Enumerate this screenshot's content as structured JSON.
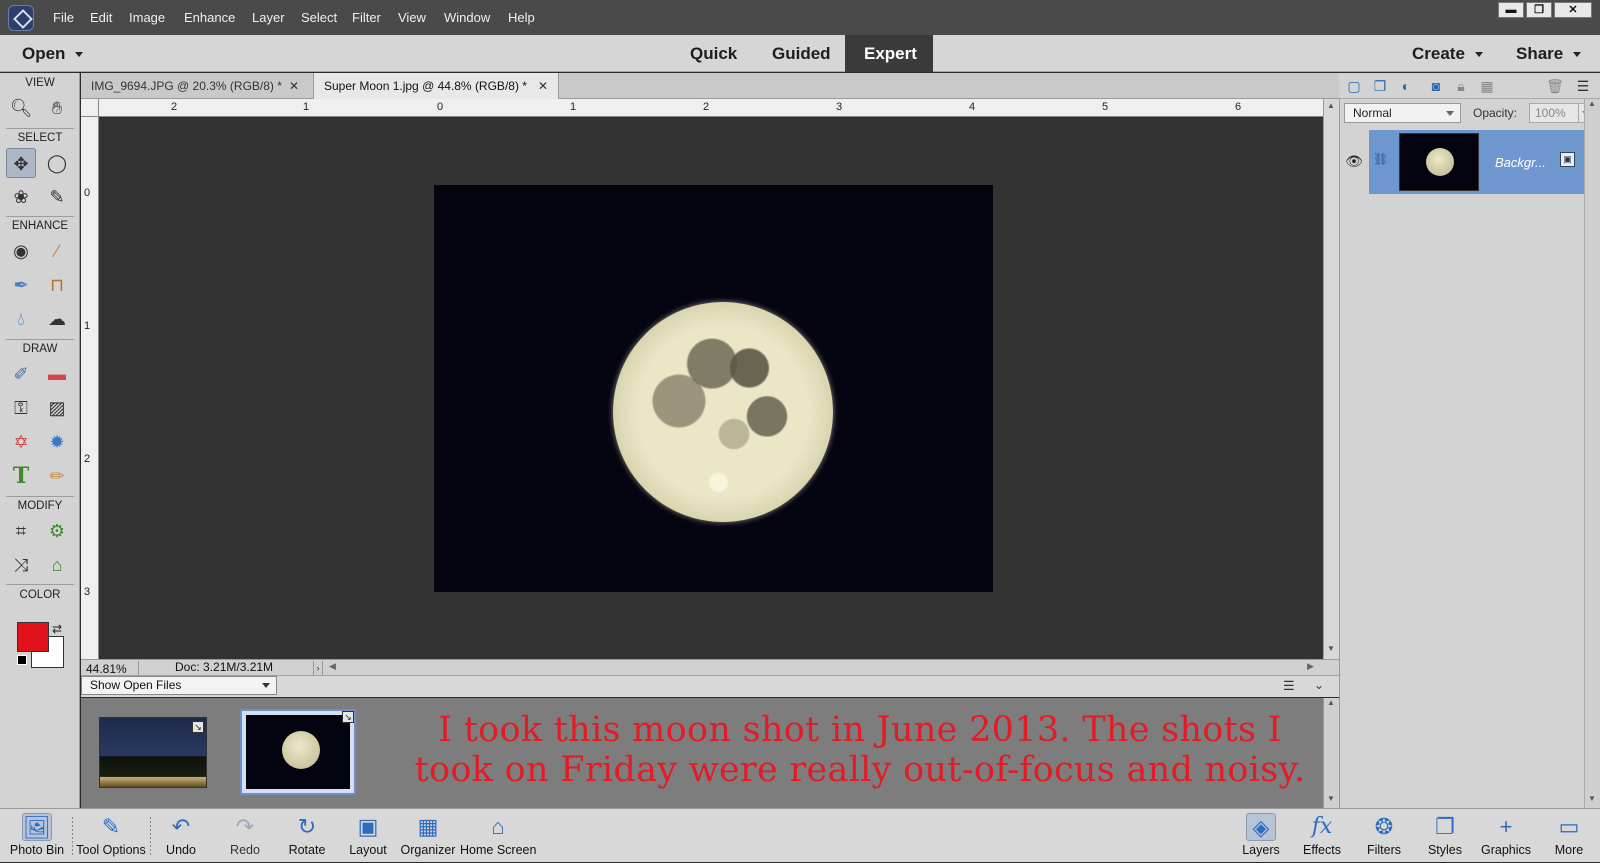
{
  "menubar": {
    "items": [
      "File",
      "Edit",
      "Image",
      "Enhance",
      "Layer",
      "Select",
      "Filter",
      "View",
      "Window",
      "Help"
    ]
  },
  "window_controls": {
    "minimize": "▬",
    "restore": "❐",
    "close": "✕"
  },
  "modebar": {
    "open": "Open",
    "modes": [
      "Quick",
      "Guided",
      "Expert"
    ],
    "active_mode": "Expert",
    "create": "Create",
    "share": "Share"
  },
  "toolbox": {
    "sections": [
      "VIEW",
      "SELECT",
      "ENHANCE",
      "DRAW",
      "MODIFY",
      "COLOR"
    ],
    "colors": {
      "foreground": "#e0111b",
      "background": "#ffffff"
    }
  },
  "tabs": [
    {
      "label": "IMG_9694.JPG @ 20.3% (RGB/8) *"
    },
    {
      "label": "Super Moon 1.jpg @ 44.8% (RGB/8) *"
    }
  ],
  "ruler_top": [
    "2",
    "1",
    "0",
    "1",
    "2",
    "3",
    "4",
    "5",
    "6"
  ],
  "ruler_left": [
    "0",
    "1",
    "2",
    "3"
  ],
  "status": {
    "zoom": "44.81%",
    "doc": "Doc: 3.21M/3.21M"
  },
  "photo_bin": {
    "dropdown": "Show Open Files",
    "caption": "I took this moon shot in June 2013. The shots I took on Friday were really out-of-focus and noisy."
  },
  "layers_panel": {
    "blend_mode": "Normal",
    "opacity_label": "Opacity:",
    "opacity_value": "100%",
    "layer_name": "Backgr..."
  },
  "taskbar": {
    "left": [
      "Photo Bin",
      "Tool Options",
      "Undo",
      "Redo",
      "Rotate",
      "Layout",
      "Organizer",
      "Home Screen"
    ],
    "right": [
      "Layers",
      "Effects",
      "Filters",
      "Styles",
      "Graphics",
      "More"
    ]
  }
}
